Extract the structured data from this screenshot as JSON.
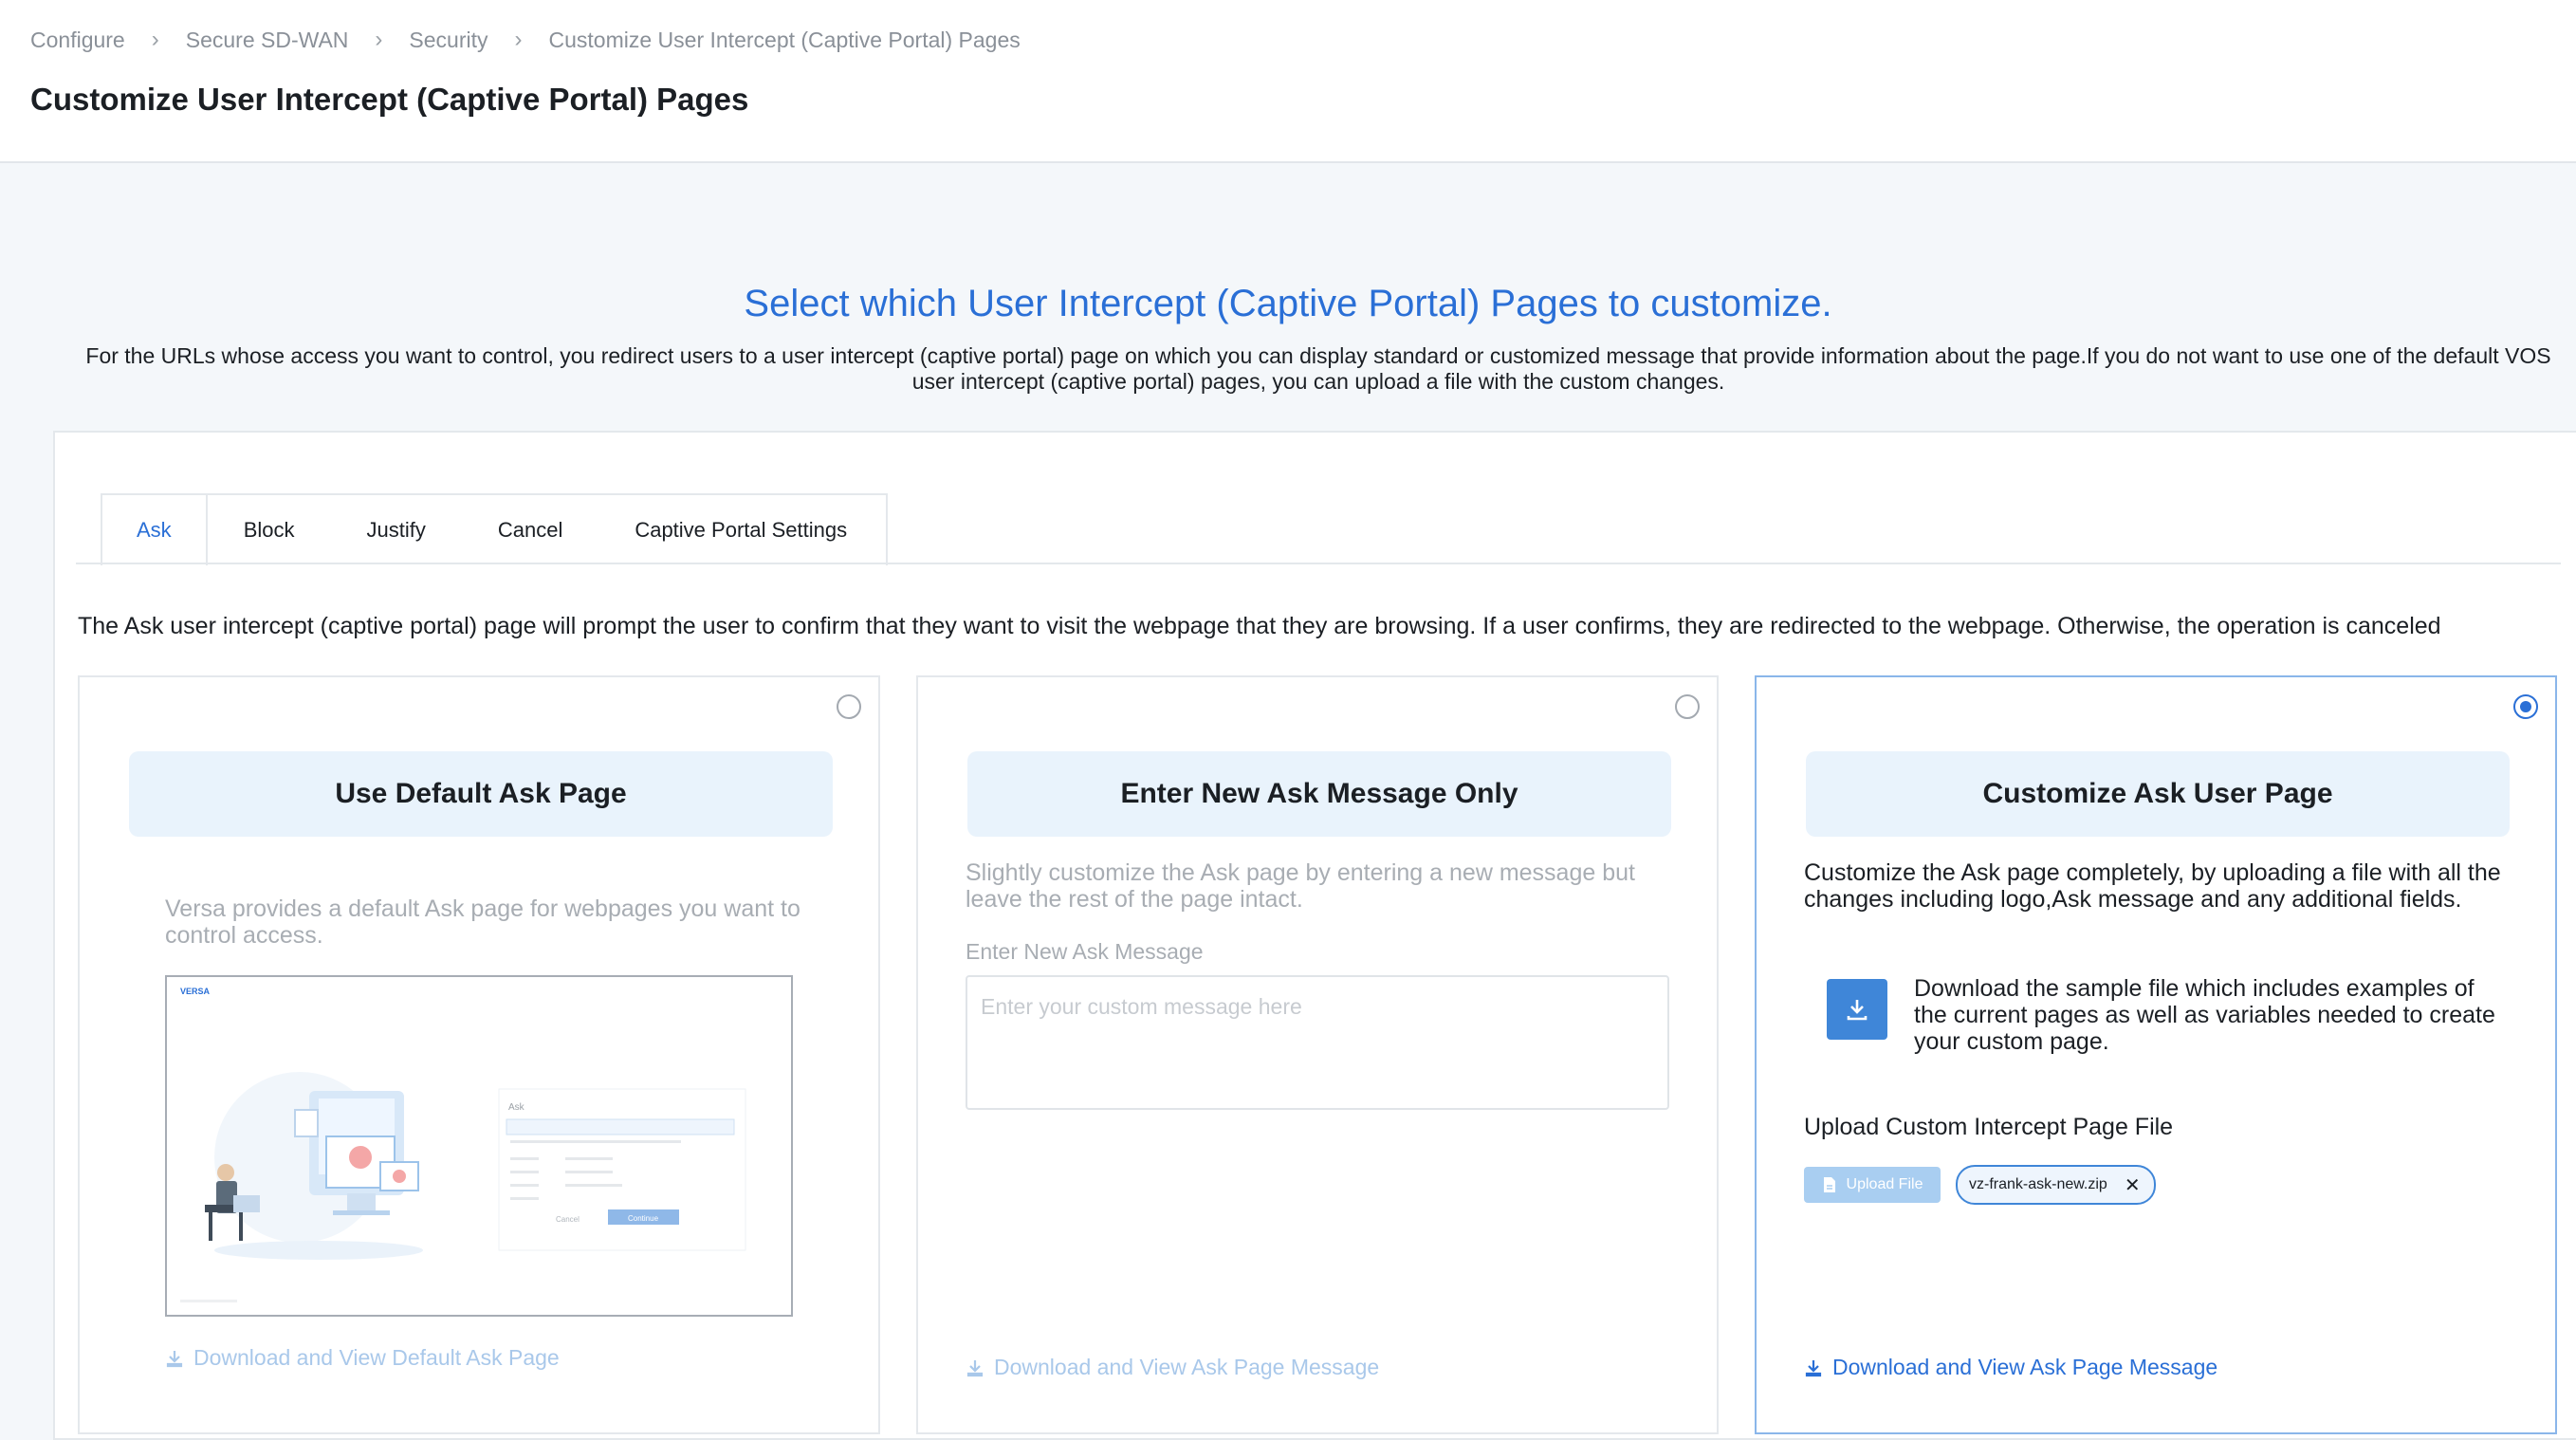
{
  "breadcrumb": [
    "Configure",
    "Secure SD-WAN",
    "Security",
    "Customize User Intercept (Captive Portal) Pages"
  ],
  "page_title": "Customize User Intercept (Captive Portal) Pages",
  "hero": {
    "title": "Select which User Intercept (Captive Portal) Pages to customize.",
    "description": "For the URLs whose access you want to control, you redirect users to a user intercept (captive portal) page on which you can display standard or customized message that provide information about the page.If you do not want to use one of the default VOS user intercept (captive portal) pages, you can upload a file with the custom changes."
  },
  "tabs": [
    "Ask",
    "Block",
    "Justify",
    "Cancel",
    "Captive Portal Settings"
  ],
  "active_tab": "Ask",
  "intro": "The Ask user intercept (captive portal) page will prompt the user to confirm that they want to visit the webpage that they are browsing. If a user confirms, they are redirected to the webpage. Otherwise, the operation is canceled",
  "cards": {
    "default": {
      "title": "Use Default Ask Page",
      "description": "Versa provides a default Ask page for webpages you want to control access.",
      "link": "Download and View Default Ask Page",
      "preview": {
        "brand": "VERSA",
        "heading": "Ask",
        "cancel": "Cancel",
        "continue": "Continue"
      }
    },
    "message": {
      "title": "Enter New Ask Message Only",
      "description": "Slightly customize the Ask page by entering a new message but leave the rest of the page intact.",
      "field_label": "Enter New Ask Message",
      "placeholder": "Enter your custom message here",
      "link": "Download and View Ask Page Message"
    },
    "custom": {
      "title": "Customize Ask User Page",
      "description": "Customize the Ask page completely, by uploading a file with all the changes including logo,Ask message and any additional fields.",
      "download_text": "Download the sample file which includes examples of the current pages as well as variables needed to create your custom page.",
      "upload_label": "Upload Custom Intercept Page File",
      "upload_button": "Upload File",
      "file_name": "vz-frank-ask-new.zip",
      "link": "Download and View Ask Page Message"
    }
  },
  "selected_option": "custom",
  "colors": {
    "accent": "#2a6fd6",
    "card_header_bg": "#e9f3fc",
    "disabled_link": "#a9c8ea"
  },
  "icons": [
    "chevron-right-icon",
    "download-icon",
    "upload-file-icon",
    "close-icon"
  ]
}
